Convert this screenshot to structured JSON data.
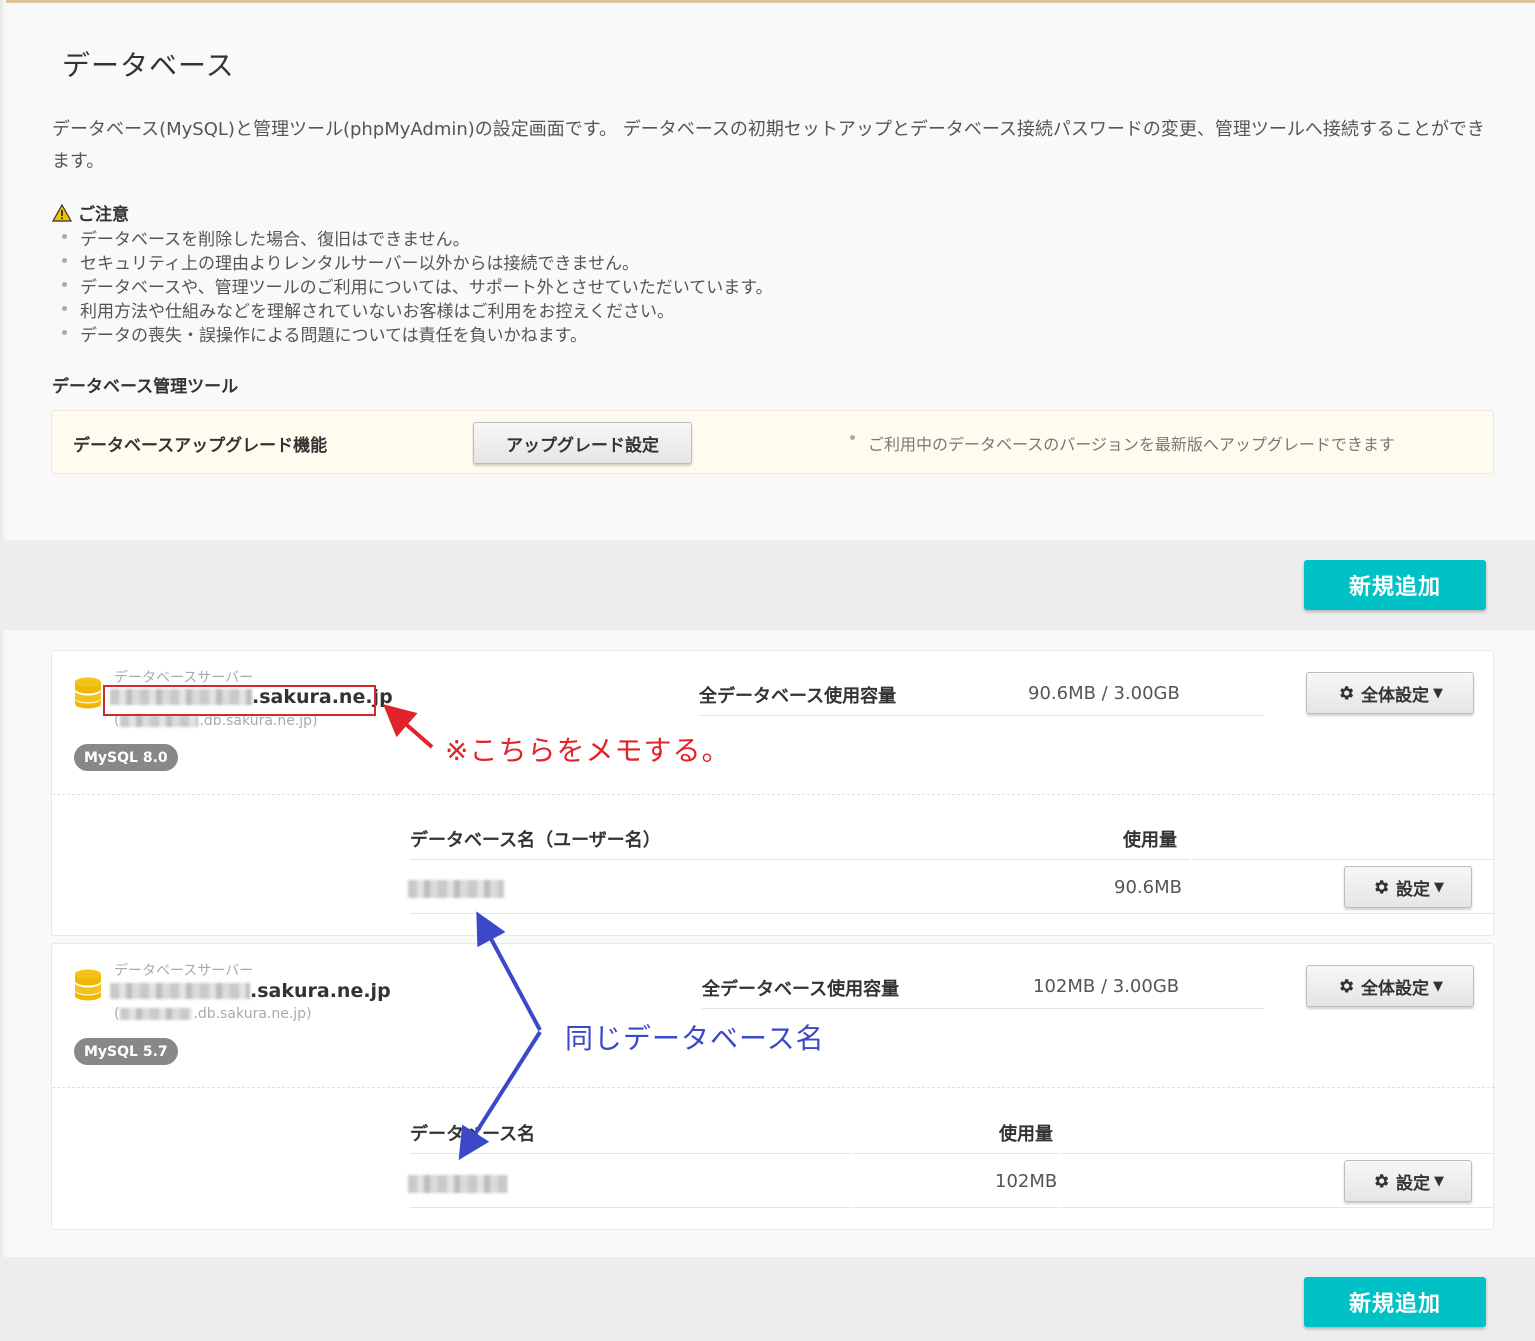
{
  "page": {
    "title": "データベース",
    "description": "データベース(MySQL)と管理ツール(phpMyAdmin)の設定画面です。 データベースの初期セットアップとデータベース接続パスワードの変更、管理ツールへ接続することができます。"
  },
  "caution": {
    "heading": "ご注意",
    "items": [
      "データベースを削除した場合、復旧はできません。",
      "セキュリティ上の理由よりレンタルサーバー以外からは接続できません。",
      "データベースや、管理ツールのご利用については、サポート外とさせていただいています。",
      "利用方法や仕組みなどを理解されていないお客様はご利用をお控えください。",
      "データの喪失・誤操作による問題については責任を負いかねます。"
    ]
  },
  "tools": {
    "heading": "データベース管理ツール",
    "upgrade_label": "データベースアップグレード機能",
    "upgrade_button": "アップグレード設定",
    "upgrade_note": "ご利用中のデータベースのバージョンを最新版へアップグレードできます"
  },
  "add_button": "新規追加",
  "servers": [
    {
      "server_label": "データベースサーバー",
      "host_suffix": ".sakura.ne.jp",
      "sub_host_open": "(",
      "sub_host_suffix": ".db.sakura.ne.jp)",
      "version_badge": "MySQL 8.0",
      "total_label": "全データベース使用容量",
      "total_value": "90.6MB / 3.00GB",
      "global_settings_button": "全体設定",
      "db_name_header": "データベース名（ユーザー名）",
      "usage_header": "使用量",
      "db_usage": "90.6MB",
      "settings_button": "設定"
    },
    {
      "server_label": "データベースサーバー",
      "host_suffix": ".sakura.ne.jp",
      "sub_host_open": "(",
      "sub_host_suffix": ".db.sakura.ne.jp)",
      "version_badge": "MySQL 5.7",
      "total_label": "全データベース使用容量",
      "total_value": "102MB / 3.00GB",
      "global_settings_button": "全体設定",
      "db_name_header": "データベース名",
      "usage_header": "使用量",
      "db_usage": "102MB",
      "settings_button": "設定"
    }
  ],
  "annotations": {
    "memo_note": "※こちらをメモする。",
    "same_db_note": "同じデータベース名"
  },
  "colors": {
    "accent_teal": "#00c1c5",
    "annotation_red": "#e0242a",
    "annotation_blue": "#3b48c8",
    "db_icon_yellow": "#f3c31b",
    "badge_grey": "#888888"
  }
}
